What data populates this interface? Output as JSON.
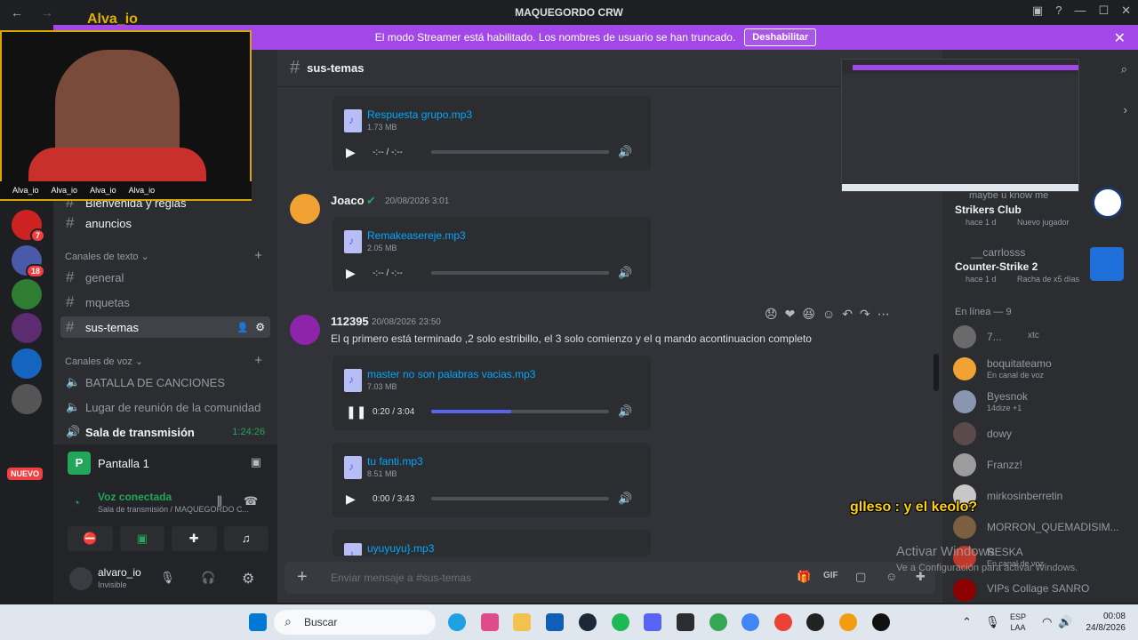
{
  "window": {
    "title": "MAQUEGORDO CRW"
  },
  "banner": {
    "text": "El modo Streamer está habilitado. Los nombres de usuario se han truncado.",
    "button": "Deshabilitar"
  },
  "overlay": {
    "streamer_name": "Alva_io",
    "socials": [
      "Alva_io",
      "Alva_io",
      "Alva_io",
      "Alva_io"
    ]
  },
  "server_badges": {
    "b1": "7",
    "b2": "18",
    "new": "NUEVO"
  },
  "sidebar": {
    "partial_top": "Bienvenida y reglas",
    "announcements": "anuncios",
    "text_category": "Canales de texto",
    "text_channels": [
      "general",
      "mquetas",
      "sus-temas"
    ],
    "voice_category": "Canales de voz",
    "voice_channels": [
      "BATALLA DE CANCIONES",
      "Lugar de reunión de la comunidad",
      "Sala de transmisión"
    ],
    "stream_timer": "1:24:26",
    "screen_share": "Pantalla 1",
    "voice_status": "Voz conectada",
    "voice_location": "Sala de transmisión / MAQUEGORDO C...",
    "user": {
      "name": "alvaro_io",
      "status": "Invisible"
    }
  },
  "channel": {
    "name": "sus-temas",
    "composer_placeholder": "Enviar mensaje a #sus-temas"
  },
  "messages": [
    {
      "attachment": {
        "name": "Respuesta grupo.mp3",
        "size": "1.73 MB",
        "time": "-:-- / -:--"
      }
    },
    {
      "author": "Joaco",
      "timestamp": "20/08/2026 3:01",
      "attachment": {
        "name": "Remakeasereje.mp3",
        "size": "2.05 MB",
        "time": "-:-- / -:--"
      }
    },
    {
      "author": "112395",
      "timestamp": "20/08/2026 23:50",
      "text": "El q primero está terminado ,2 solo estribillo, el 3 solo comienzo y el q mando acontinuacion completo",
      "attachments": [
        {
          "name": "master no son palabras vacias.mp3",
          "size": "7.03 MB",
          "time": "0:20 / 3:04",
          "progress": 0.45
        },
        {
          "name": "tu fanti.mp3",
          "size": "8.51 MB",
          "time": "0:00 / 3:43",
          "progress": 0
        },
        {
          "name": "uyuyuyu}.mp3"
        }
      ]
    }
  ],
  "activity": [
    {
      "partial": "maybe u know me"
    },
    {
      "name": "Strikers Club",
      "status": "hace 1 d",
      "extra": "Nuevo jugador"
    },
    {
      "user": "__carrlosss",
      "name": "Counter-Strike 2",
      "status": "hace 1 d",
      "extra": "Racha de x5 días"
    }
  ],
  "members": {
    "header": "En línea — 9",
    "list": [
      {
        "name": "7...",
        "tag": "xtc"
      },
      {
        "name": "boquitateamo",
        "status": "En canal de voz"
      },
      {
        "name": "Byesnok",
        "status": "14dize +1"
      },
      {
        "name": "dowy"
      },
      {
        "name": "Franzz!"
      },
      {
        "name": "mirkosinberretin"
      },
      {
        "name": "MORRON_QUEMADISIM..."
      },
      {
        "name": "RESKA",
        "status": "En canal de voz"
      },
      {
        "name": "VIPs Collage SANRO"
      }
    ]
  },
  "caption": "glleso : y el keolo?",
  "watermark": {
    "line1": "Activar Windows",
    "line2": "Ve a Configuración para activar Windows."
  },
  "taskbar": {
    "search": "Buscar",
    "lang": "ESP",
    "lang2": "LAA",
    "time": "00:08",
    "date": "24/8/2026"
  }
}
